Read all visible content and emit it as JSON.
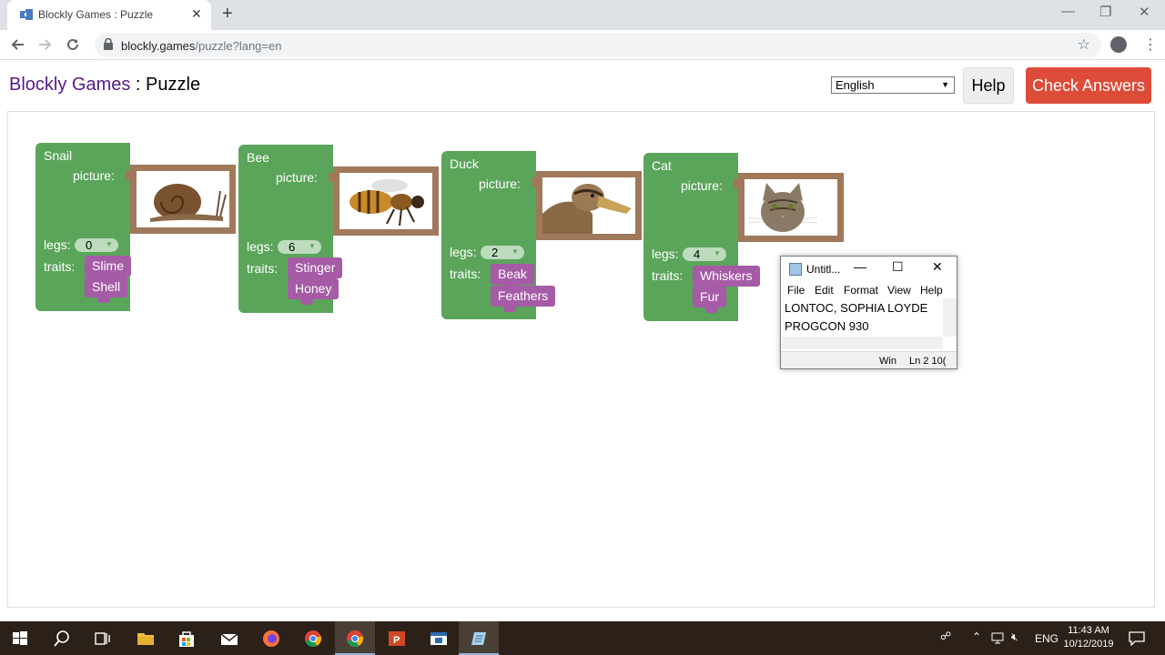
{
  "browser": {
    "tab_title": "Blockly Games : Puzzle",
    "tab_close": "✕",
    "new_tab": "+",
    "url_host": "blockly.games",
    "url_path": "/puzzle?lang=en",
    "win_min": "—",
    "win_restore": "❐",
    "win_close": "✕"
  },
  "header": {
    "title_link": "Blockly Games",
    "title_sep": " : ",
    "title_page": "Puzzle",
    "language": "English",
    "help_label": "Help",
    "check_label": "Check Answers"
  },
  "animals": [
    {
      "name": "Snail",
      "picture_label": "picture:",
      "legs_label": "legs:",
      "legs": "0",
      "traits_label": "traits:",
      "traits": [
        "Slime",
        "Shell"
      ]
    },
    {
      "name": "Bee",
      "picture_label": "picture:",
      "legs_label": "legs:",
      "legs": "6",
      "traits_label": "traits:",
      "traits": [
        "Stinger",
        "Honey"
      ]
    },
    {
      "name": "Duck",
      "picture_label": "picture:",
      "legs_label": "legs:",
      "legs": "2",
      "traits_label": "traits:",
      "traits": [
        "Beak",
        "Feathers"
      ]
    },
    {
      "name": "Cat",
      "picture_label": "picture:",
      "legs_label": "legs:",
      "legs": "4",
      "traits_label": "traits:",
      "traits": [
        "Whiskers",
        "Fur"
      ]
    }
  ],
  "notepad": {
    "title": "Untitl...",
    "menu": [
      "File",
      "Edit",
      "Format",
      "View",
      "Help"
    ],
    "line1": "LONTOC, SOPHIA LOYDE",
    "line2": "PROGCON 930",
    "status_encoding": "Win",
    "status_pos": "Ln 2 10("
  },
  "taskbar": {
    "tray_lang": "ENG",
    "time": "11:43 AM",
    "date": "10/12/2019"
  },
  "colors": {
    "block_green": "#5ba55b",
    "trait_purple": "#a55ba5",
    "check_red": "#dd4b39",
    "frame_brown": "#a0785a"
  }
}
